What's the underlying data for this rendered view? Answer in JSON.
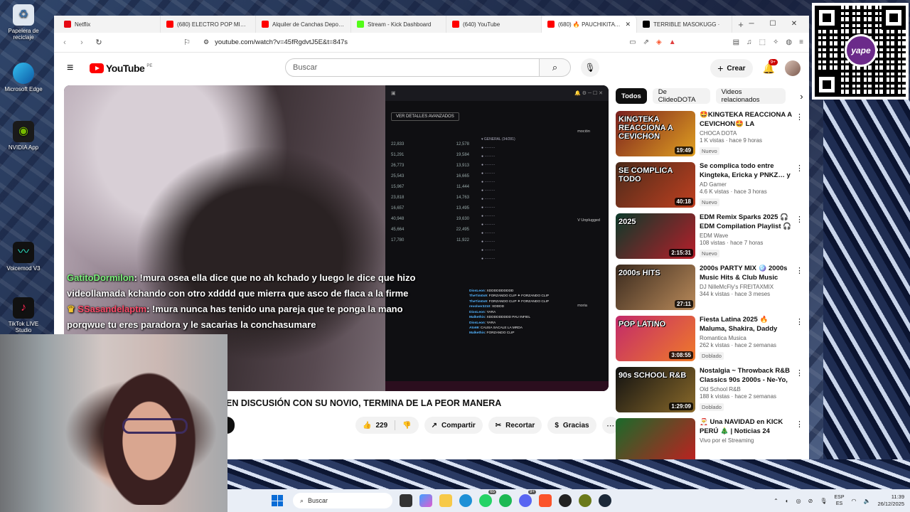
{
  "desktop": {
    "icons": [
      {
        "label": "Papelera de reciclaje",
        "icon": "recycle-bin-icon"
      },
      {
        "label": "Microsoft Edge",
        "icon": "edge-icon"
      },
      {
        "label": "NVIDIA App",
        "icon": "nvidia-icon"
      },
      {
        "label": "Voicemod V3",
        "icon": "voicemod-icon"
      },
      {
        "label": "TikTok LIVE Studio",
        "icon": "tiktok-icon"
      }
    ]
  },
  "browser": {
    "tabs": [
      {
        "title": "Netflix",
        "color": "#e50914"
      },
      {
        "title": "(680) ELECTRO POP MIX 200…",
        "color": "#ff0000"
      },
      {
        "title": "Alquiler de Canchas Deport…",
        "color": "#ff0000"
      },
      {
        "title": "Stream - Kick Dashboard",
        "color": "#53fc18"
      },
      {
        "title": "(640) YouTube",
        "color": "#ff0000"
      },
      {
        "title": "(680) 🔥 PAUCHIKITA Fl…",
        "color": "#ff0000",
        "active": true
      },
      {
        "title": "TERRIBLE MASOKUGG ·",
        "color": "#000000"
      }
    ],
    "url": "youtube.com/watch?v=45fRgdvtJ5E&t=847s"
  },
  "youtube": {
    "wordmark": "YouTube",
    "country": "PE",
    "search_placeholder": "Buscar",
    "create_label": "Crear",
    "notif_badge": "9+",
    "chat_overlay": {
      "line1_user": "GatitoDormilon",
      "line1_text": ": !mura osea ella dice que no ah kchado y luego le dice que hizo videollamada kchando con otro xdddd que mierra que asco de flaca a la firme",
      "line2_user": "SSasandelaptm",
      "line2_text": ": !mura nunca has tenido una pareja que te ponga la mano porqwue tu eres paradora y le sacarias la conchasumare"
    },
    "stream_panel": {
      "button_label": "VER DETALLES AVANZADOS",
      "side_label_1": "moción",
      "side_label_2": "V Unplugged",
      "side_label_3": "moria",
      "stats": [
        "22,833",
        "12,578",
        "51,291",
        "19,584",
        "26,773",
        "13,913",
        "25,543",
        "16,665",
        "15,967",
        "11,444",
        "23,818",
        "14,763",
        "16,657",
        "13,495",
        "40,948",
        "19,630",
        "45,664",
        "22,495",
        "17,780",
        "11,922"
      ],
      "chat": [
        {
          "u": "DiosLeon",
          "m": ": XDDDDDDDDDD"
        },
        {
          "u": "TheTim0x9",
          "m": ": FORZANDO CLIP ✦ FORZANDO CLIP"
        },
        {
          "u": "TheTim0x9",
          "m": ": FORZANDO CLIP ✦ FORZANDO CLIP"
        },
        {
          "u": "revolver3210",
          "m": ": XDDDD"
        },
        {
          "u": "DiosLeon",
          "m": ": YARA"
        },
        {
          "u": "Malkethis",
          "m": ": XDDDDDDDDD PAU INFIEL"
        },
        {
          "u": "DiosLeon",
          "m": ": YARA"
        },
        {
          "u": "Ato69",
          "m": ": CAUSA SACALE LA MRDA"
        },
        {
          "u": "Malkethis",
          "m": ": FORZANDO CLIP"
        }
      ]
    },
    "video_title": "EN DISCUSIÓN CON SU NOVIO, TERMINA DE LA PEOR MANERA",
    "actions": {
      "likes": "229",
      "share": "Compartir",
      "clip": "Recortar",
      "thanks": "Gracias"
    },
    "chips": [
      "Todos",
      "De ClideoDOTA",
      "Videos relacionados"
    ],
    "recommendations": [
      {
        "thumb_text": "KINGTEKA REACCIONA A CEVICHON",
        "thumb_colors": [
          "#7a1f1f",
          "#e0a020"
        ],
        "duration": "19:49",
        "title": "🤩KINGTEKA REACCIONA A CEVICHON🤩 LA DECADENCI…",
        "channel": "CHOCA DOTA",
        "stats": "1 K vistas · hace 9 horas",
        "badge": "Nuevo"
      },
      {
        "thumb_text": "SE COMPLICA TODO",
        "thumb_colors": [
          "#4a2a1a",
          "#c04020"
        ],
        "duration": "40:18",
        "title": "Se complica todo entre Kingteka, Ericka y PNKZ… y …",
        "channel": "AD Gamer",
        "stats": "4.6 K vistas · hace 3 horas",
        "badge": "Nuevo"
      },
      {
        "thumb_text": "2025",
        "thumb_colors": [
          "#0b3a2a",
          "#b81e2a"
        ],
        "duration": "2:15:31",
        "title": "EDM Remix Sparks 2025 🎧 EDM Compilation Playlist 🎧 …",
        "channel": "EDM Wave",
        "stats": "108 vistas · hace 7 horas",
        "badge": "Nuevo"
      },
      {
        "thumb_text": "2000s HITS",
        "thumb_colors": [
          "#3a2a1e",
          "#b98a5a"
        ],
        "duration": "27:11",
        "title": "2000s PARTY MIX 🪩 2000s Music Hits & Club Music Mixe…",
        "channel": "DJ NilleMcFly's FREITAXMIX",
        "stats": "344 k vistas · hace 3 meses",
        "badge": ""
      },
      {
        "thumb_text": "POP LATINO",
        "thumb_colors": [
          "#c22a6a",
          "#f07a2a"
        ],
        "duration": "3:08:55",
        "title": "Fiesta Latina 2025 🔥 Maluma, Shakira, Daddy Yankee, Wisin, …",
        "channel": "Romantica Musica",
        "stats": "262 k vistas · hace 2 semanas",
        "badge": "Doblado"
      },
      {
        "thumb_text": "90s SCHOOL R&B",
        "thumb_colors": [
          "#111111",
          "#8a6a2a"
        ],
        "duration": "1:29:09",
        "title": "Nostalgia ~ Throwback R&B Classics 90s 2000s - Ne-Yo, …",
        "channel": "Old School R&B",
        "stats": "188 k vistas · hace 2 semanas",
        "badge": "Doblado"
      },
      {
        "thumb_text": "",
        "thumb_colors": [
          "#1a6a2a",
          "#c02020"
        ],
        "duration": "",
        "title": "🎅 Una NAVIDAD en KICK PERÚ 🎄 | Noticias 24 diciembre",
        "channel": "Vivo por el Streaming",
        "stats": "",
        "badge": ""
      }
    ]
  },
  "qr": {
    "brand": "yape"
  },
  "taskbar": {
    "search_placeholder": "Buscar",
    "lang_top": "ESP",
    "lang_bottom": "ES",
    "time": "11:39",
    "date": "26/12/2025",
    "whatsapp_badge": "65",
    "discord_badge": "9+"
  }
}
